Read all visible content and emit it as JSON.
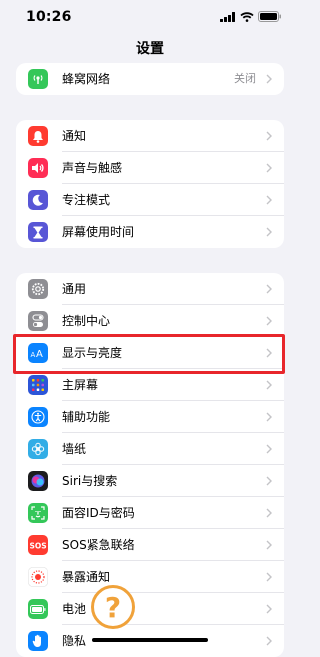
{
  "status_bar": {
    "time": "10:26"
  },
  "nav": {
    "title": "设置"
  },
  "groups": {
    "connectivity": {
      "items": [
        {
          "label": "蜂窝网络",
          "value": "关闭",
          "icon": "cellular-icon",
          "color": "#34c759"
        }
      ]
    },
    "notifications": {
      "items": [
        {
          "label": "通知",
          "icon": "bell-icon",
          "color": "#ff3b30"
        },
        {
          "label": "声音与触感",
          "icon": "speaker-icon",
          "color": "#ff2d55"
        },
        {
          "label": "专注模式",
          "icon": "moon-icon",
          "color": "#5856d6"
        },
        {
          "label": "屏幕使用时间",
          "icon": "hourglass-icon",
          "color": "#5856d6"
        }
      ]
    },
    "general": {
      "items": [
        {
          "label": "通用",
          "icon": "gear-icon",
          "color": "#8e8e93"
        },
        {
          "label": "控制中心",
          "icon": "toggles-icon",
          "color": "#8e8e93"
        },
        {
          "label": "显示与亮度",
          "icon": "text-size-icon",
          "color": "#0a84ff"
        },
        {
          "label": "主屏幕",
          "icon": "home-grid-icon",
          "color": "#2c55d8"
        },
        {
          "label": "辅助功能",
          "icon": "accessibility-icon",
          "color": "#0a84ff"
        },
        {
          "label": "墙纸",
          "icon": "flower-icon",
          "color": "#32ade6"
        },
        {
          "label": "Siri与搜索",
          "icon": "siri-icon",
          "color": "#1c1c1e"
        },
        {
          "label": "面容ID与密码",
          "icon": "face-id-icon",
          "color": "#34c759"
        },
        {
          "label": "SOS紧急联络",
          "icon": "sos-icon",
          "color": "#ff3b30"
        },
        {
          "label": "暴露通知",
          "icon": "exposure-icon",
          "color": "#ffffff"
        },
        {
          "label": "电池",
          "icon": "battery-icon",
          "color": "#34c759"
        },
        {
          "label": "隐私",
          "icon": "hand-icon",
          "color": "#0a84ff"
        }
      ]
    }
  },
  "overlay": {
    "help_glyph": "?"
  },
  "colors": {
    "highlight": "#e8262b",
    "help": "#f0a23a",
    "background": "#f2f2f7"
  }
}
